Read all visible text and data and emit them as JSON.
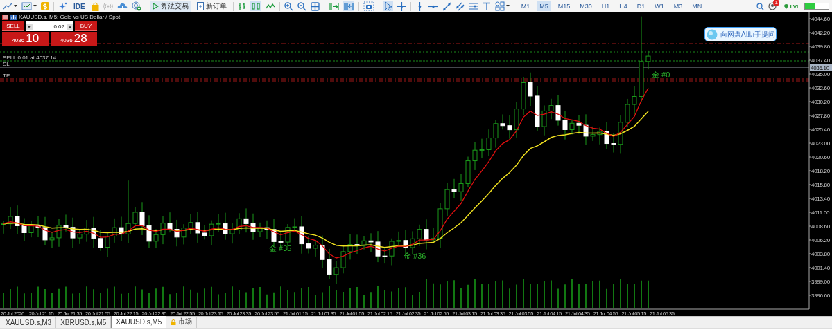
{
  "toolbar": {
    "ide_label": "IDE",
    "algo_trading": {
      "label": "算法交易",
      "on": true
    },
    "new_order": "新订单",
    "timeframes": [
      {
        "label": "M1",
        "selected": false
      },
      {
        "label": "M5",
        "selected": true
      },
      {
        "label": "M15",
        "selected": false
      },
      {
        "label": "M30",
        "selected": false
      },
      {
        "label": "H1",
        "selected": false
      },
      {
        "label": "H4",
        "selected": false
      },
      {
        "label": "D1",
        "selected": false
      },
      {
        "label": "W1",
        "selected": false
      },
      {
        "label": "M3",
        "selected": false
      },
      {
        "label": "MN",
        "selected": false
      }
    ],
    "notification_count": "1",
    "level_badge": "LVL",
    "meter": {
      "level": 0.45
    }
  },
  "chart": {
    "title": "XAUUSD.s, M5:  Gold vs US Dollar / Spot",
    "trade_panel": {
      "sell_label": "SELL",
      "buy_label": "BUY",
      "lot": "0.02",
      "lot_down": "▾",
      "lot_up": "▴",
      "sell_price_small": "4036",
      "sell_price_big": "10",
      "buy_price_small": "4036",
      "buy_price_big": "28"
    },
    "order_labels": [
      "SELL 0.01 at 4037.14",
      "SL",
      "TP"
    ],
    "ai_button": "向网盘AI助手提问",
    "position_labels": [
      "金 #0",
      "金 #35",
      "金 #36"
    ],
    "current_price": "4036.10",
    "price_ticks": [
      "4044.60",
      "4042.20",
      "4039.80",
      "4037.40",
      "4035.00",
      "4032.60",
      "4030.20",
      "4027.80",
      "4025.40",
      "4023.00",
      "4020.60",
      "4018.20",
      "4015.80",
      "4013.40",
      "4011.00",
      "4008.60",
      "4006.20",
      "4003.80",
      "4001.40",
      "3999.00",
      "3996.60"
    ],
    "time_ticks": [
      "20 Jul 2026",
      "20 Jul 21:15",
      "20 Jul 21:35",
      "20 Jul 21:55",
      "20 Jul 22:15",
      "20 Jul 22:35",
      "20 Jul 22:55",
      "20 Jul 23:15",
      "20 Jul 23:35",
      "20 Jul 23:55",
      "21 Jul 01:15",
      "21 Jul 01:35",
      "21 Jul 01:55",
      "21 Jul 02:15",
      "21 Jul 02:35",
      "21 Jul 02:55",
      "21 Jul 03:15",
      "21 Jul 03:35",
      "21 Jul 03:55",
      "21 Jul 04:15",
      "21 Jul 04:35",
      "21 Jul 04:55",
      "21 Jul 05:15",
      "21 Jul 05:35"
    ]
  },
  "tabs": [
    {
      "label": "XAUUSD.s,M3",
      "selected": false,
      "kind": "chart"
    },
    {
      "label": "XBRUSD.s,M5",
      "selected": false,
      "kind": "chart"
    },
    {
      "label": "XAUUSD.s,M5",
      "selected": true,
      "kind": "chart"
    },
    {
      "label": "市场",
      "selected": false,
      "kind": "market"
    }
  ]
}
